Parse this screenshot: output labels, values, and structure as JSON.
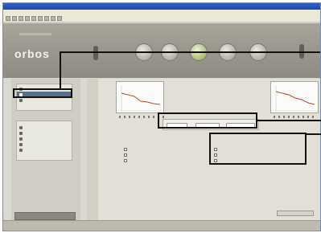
{
  "window": {
    "title": ""
  },
  "menu": {
    "items": [
      "",
      "",
      "",
      "",
      "",
      "",
      "",
      ""
    ]
  },
  "toolbar": {
    "icons": [
      "new-icon",
      "open-icon",
      "save-icon",
      "print-icon",
      "undo-icon",
      "redo-icon",
      "cut-icon",
      "copy-icon",
      "paste-icon"
    ]
  },
  "brand": {
    "logo": "orbos"
  },
  "nav_buttons": [
    {
      "label": "",
      "icon": "settings-icon"
    },
    {
      "label": "",
      "icon": "clock-icon"
    },
    {
      "label": "",
      "icon": "chart-icon"
    },
    {
      "label": "",
      "icon": "refresh-icon"
    },
    {
      "label": "",
      "icon": "bell-icon"
    }
  ],
  "sidebar": {
    "group1": [
      "",
      "",
      ""
    ],
    "group2": [
      "",
      "",
      "",
      "",
      ""
    ]
  },
  "main": {
    "left_section_title": "",
    "right_section_title": "",
    "left_options": [
      "",
      "",
      ""
    ],
    "right_options": [
      "",
      "",
      ""
    ]
  },
  "colors": {
    "accent": "#b23d24",
    "header": "#9c9a90",
    "callout": "#111111"
  }
}
